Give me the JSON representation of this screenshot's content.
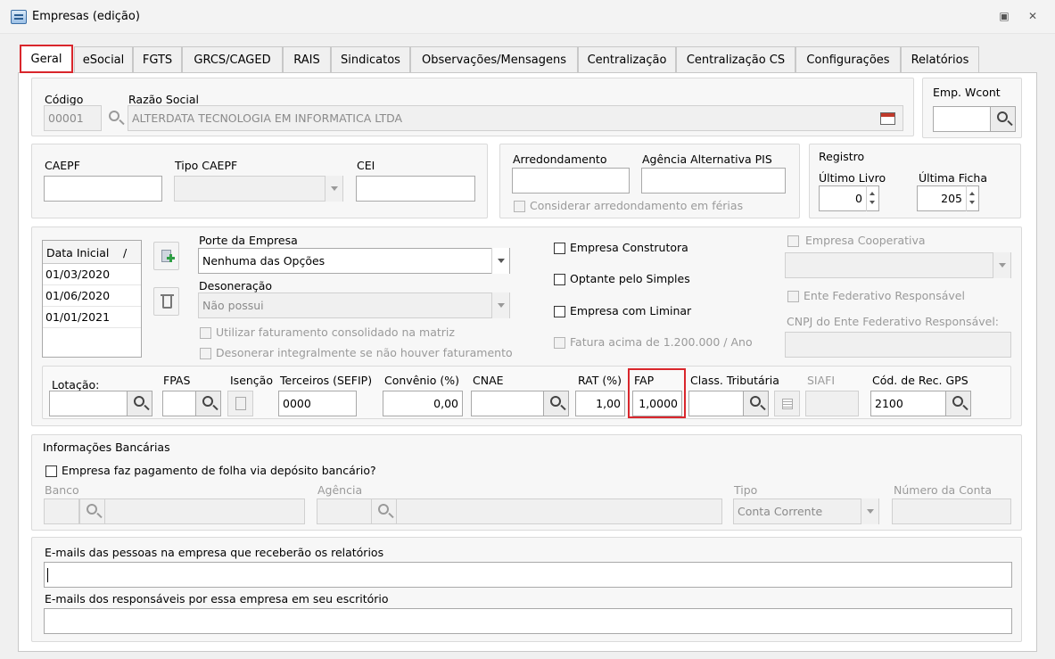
{
  "window": {
    "title": "Empresas (edição)",
    "restore_glyph": "▣",
    "close_glyph": "✕"
  },
  "tabs": [
    {
      "label": "Geral"
    },
    {
      "label": "eSocial"
    },
    {
      "label": "FGTS"
    },
    {
      "label": "GRCS/CAGED"
    },
    {
      "label": "RAIS"
    },
    {
      "label": "Sindicatos"
    },
    {
      "label": "Observações/Mensagens"
    },
    {
      "label": "Centralização"
    },
    {
      "label": "Centralização CS"
    },
    {
      "label": "Configurações"
    },
    {
      "label": "Relatórios"
    }
  ],
  "company": {
    "codigo_label": "Código",
    "codigo_value": "00001",
    "razao_label": "Razão Social",
    "razao_value": "ALTERDATA TECNOLOGIA EM INFORMATICA LTDA",
    "emp_wcont_label": "Emp. Wcont",
    "emp_wcont_value": ""
  },
  "caepf": {
    "caepf_label": "CAEPF",
    "caepf_value": "",
    "tipo_label": "Tipo CAEPF",
    "tipo_value": "",
    "cei_label": "CEI",
    "cei_value": ""
  },
  "rounding": {
    "arred_label": "Arredondamento",
    "arred_value": "",
    "agencia_pis_label": "Agência Alternativa PIS",
    "agencia_pis_value": "",
    "ferias_label": "Considerar arredondamento em férias"
  },
  "registro": {
    "title": "Registro",
    "livro_label": "Último Livro",
    "livro_value": "0",
    "ficha_label": "Última Ficha",
    "ficha_value": "205"
  },
  "dates": {
    "header": "Data Inicial",
    "sort_glyph": "/",
    "rows": [
      "01/03/2020",
      "01/06/2020",
      "01/01/2021"
    ]
  },
  "porte": {
    "label": "Porte da Empresa",
    "value": "Nenhuma das Opções",
    "desoneracao_label": "Desoneração",
    "desoneracao_value": "Não possui",
    "fat_consolidado": "Utilizar faturamento consolidado na matriz",
    "desonerar_integral": "Desonerar integralmente se não houver faturamento"
  },
  "flags": {
    "construtora": "Empresa Construtora",
    "simples": "Optante pelo Simples",
    "liminar": "Empresa com Liminar",
    "fatura": "Fatura acima de 1.200.000 / Ano",
    "cooperativa": "Empresa Cooperativa",
    "ente_label": "Ente Federativo Responsável",
    "cnpj_ente_label": "CNPJ do Ente Federativo Responsável:"
  },
  "fiscal": {
    "lotacao_label": "Lotação:",
    "lotacao_value": "",
    "fpas_label": "FPAS",
    "fpas_value": "",
    "isencao_label": "Isenção",
    "terceiros_label": "Terceiros (SEFIP)",
    "terceiros_value": "0000",
    "convenio_label": "Convênio (%)",
    "convenio_value": "0,00",
    "cnae_label": "CNAE",
    "cnae_value": "",
    "rat_label": "RAT (%)",
    "rat_value": "1,00",
    "fap_label": "FAP",
    "fap_value": "1,0000",
    "class_label": "Class. Tributária",
    "class_value": "",
    "siafi_label": "SIAFI",
    "siafi_value": "",
    "gps_label": "Cód. de Rec. GPS",
    "gps_value": "2100"
  },
  "banking": {
    "title": "Informações Bancárias",
    "deposito": "Empresa faz pagamento de folha via depósito bancário?",
    "banco_label": "Banco",
    "agencia_label": "Agência",
    "tipo_label": "Tipo",
    "tipo_value": "Conta Corrente",
    "conta_label": "Número da Conta"
  },
  "emails": {
    "empresa_label": "E-mails das pessoas na empresa que receberão os relatórios",
    "escritorio_label": "E-mails dos responsáveis por essa empresa em seu escritório"
  },
  "colors": {
    "accent_red": "#d9262c",
    "border": "#c8c8c8"
  },
  "icons": [
    "app-icon",
    "restore-icon",
    "close-icon",
    "search-icon",
    "calendar-icon",
    "add-document-icon",
    "trash-icon",
    "list-icon"
  ]
}
